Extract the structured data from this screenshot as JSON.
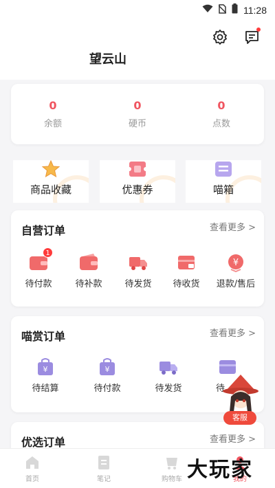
{
  "status": {
    "time": "11:28"
  },
  "header": {
    "username": "望云山"
  },
  "assets": [
    {
      "value": "0",
      "label": "余额"
    },
    {
      "value": "0",
      "label": "硬币"
    },
    {
      "value": "0",
      "label": "点数"
    }
  ],
  "shortcuts": [
    {
      "label": "商品收藏",
      "icon": "star-icon"
    },
    {
      "label": "优惠券",
      "icon": "coupon-icon"
    },
    {
      "label": "喵箱",
      "icon": "box-icon"
    }
  ],
  "self_orders": {
    "title": "自营订单",
    "more": "查看更多 >",
    "items": [
      {
        "label": "待付款",
        "icon": "wallet-icon",
        "badge": "1"
      },
      {
        "label": "待补款",
        "icon": "wallet-icon"
      },
      {
        "label": "待发货",
        "icon": "truck-icon"
      },
      {
        "label": "待收货",
        "icon": "package-icon"
      },
      {
        "label": "退款/售后",
        "icon": "refund-icon"
      }
    ]
  },
  "reward_orders": {
    "title": "喵赏订单",
    "more": "查看更多 >",
    "items": [
      {
        "label": "待结算",
        "icon": "bag-icon"
      },
      {
        "label": "待付款",
        "icon": "bag-icon"
      },
      {
        "label": "待发货",
        "icon": "truck-icon"
      },
      {
        "label": "待",
        "icon": "package-icon"
      }
    ]
  },
  "select_orders": {
    "title": "优选订单",
    "more": "查看更多 >"
  },
  "customer_service": "客服",
  "tabbar": [
    {
      "label": "首页",
      "icon": "home-icon"
    },
    {
      "label": "笔记",
      "icon": "note-icon"
    },
    {
      "label": "购物车",
      "icon": "cart-icon"
    },
    {
      "label": "我的",
      "icon": "profile-icon"
    }
  ],
  "watermark": "大玩家",
  "colors": {
    "accent": "#f05560",
    "order_icon": "#f06a6a",
    "reward_icon": "#9b8ce0"
  }
}
